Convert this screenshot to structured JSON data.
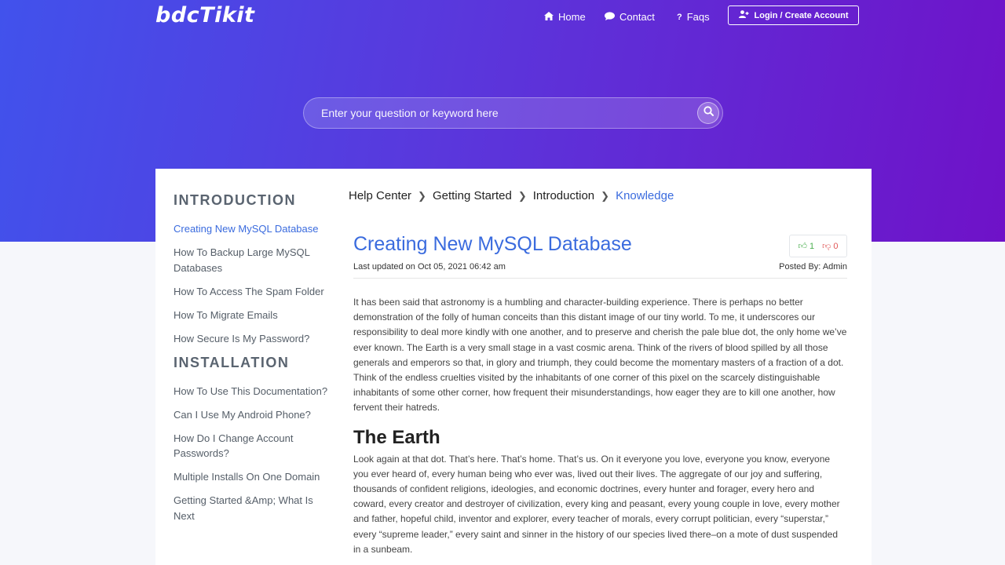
{
  "brand": {
    "logo": "bdcTikit"
  },
  "nav": {
    "home": "Home",
    "contact": "Contact",
    "faqs": "Faqs",
    "login": "Login / Create Account"
  },
  "search": {
    "placeholder": "Enter your question or keyword here"
  },
  "sidebar": {
    "sections": [
      {
        "heading": "INTRODUCTION",
        "items": [
          "Creating New MySQL Database",
          "How To Backup Large MySQL Databases",
          "How To Access The Spam Folder",
          "How To Migrate Emails",
          "How Secure Is My Password?"
        ]
      },
      {
        "heading": "INSTALLATION",
        "items": [
          "How To Use This Documentation?",
          "Can I Use My Android Phone?",
          "How Do I Change Account Passwords?",
          "Multiple Installs On One Domain",
          "Getting Started &Amp; What Is Next"
        ]
      }
    ]
  },
  "breadcrumb": [
    "Help Center",
    "Getting Started",
    "Introduction",
    "Knowledge"
  ],
  "article": {
    "title": "Creating New MySQL Database",
    "upvotes": "1",
    "downvotes": "0",
    "updated": "Last updated on Oct 05, 2021 06:42 am",
    "posted_by": "Posted By: Admin",
    "intro": "It has been said that astronomy is a humbling and character-building experience. There is perhaps no better demonstration of the folly of human conceits than this distant image of our tiny world. To me, it underscores our responsibility to deal more kindly with one another, and to preserve and cherish the pale blue dot, the only home we’ve ever known. The Earth is a very small stage in a vast cosmic arena. Think of the rivers of blood spilled by all those generals and emperors so that, in glory and triumph, they could become the momentary masters of a fraction of a dot. Think of the endless cruelties visited by the inhabitants of one corner of this pixel on the scarcely distinguishable inhabitants of some other corner, how frequent their misunderstandings, how eager they are to kill one another, how fervent their hatreds.",
    "heading": "The Earth",
    "body": "Look again at that dot. That’s here. That’s home. That’s us. On it everyone you love, everyone you know, everyone you ever heard of, every human being who ever was, lived out their lives. The aggregate of our joy and suffering, thousands of confident religions, ideologies, and economic doctrines, every hunter and forager, every hero and coward, every creator and destroyer of civilization, every king and peasant, every young couple in love, every mother and father, hopeful child, inventor and explorer, every teacher of morals, every corrupt politician, every “superstar,” every “supreme leader,” every saint and sinner in the history of our species lived there–on a mote of dust suspended in a sunbeam."
  }
}
